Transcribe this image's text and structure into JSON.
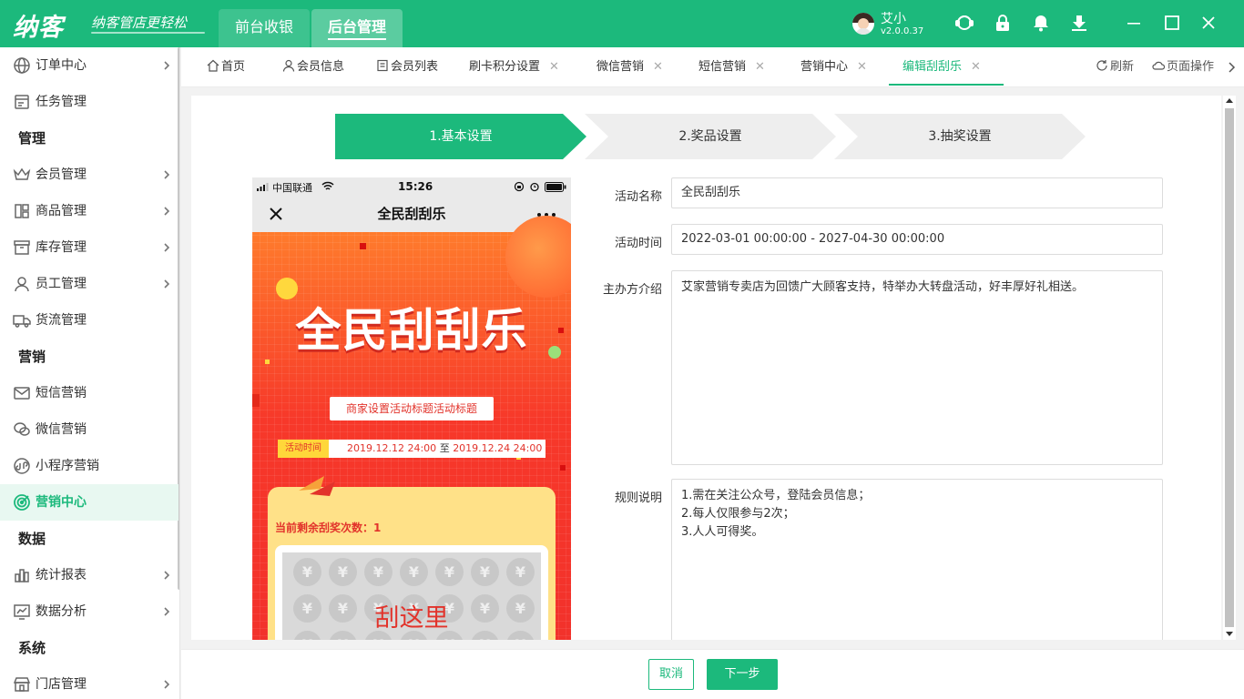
{
  "brand": {
    "logo": "纳客",
    "slogan": "纳客管店更轻松",
    "accent_color": "#1cb97c"
  },
  "main_tabs": [
    {
      "label": "前台收银"
    },
    {
      "label": "后台管理"
    }
  ],
  "user": {
    "name": "艾小",
    "version": "v2.0.0.37"
  },
  "sidebar": {
    "items": [
      {
        "label": "订单中心",
        "icon": "globe-icon"
      },
      {
        "label": "任务管理",
        "icon": "task-icon"
      },
      {
        "label": "会员管理",
        "icon": "crown-icon"
      },
      {
        "label": "商品管理",
        "icon": "grid-icon"
      },
      {
        "label": "库存管理",
        "icon": "box-icon"
      },
      {
        "label": "员工管理",
        "icon": "user-icon"
      },
      {
        "label": "货流管理",
        "icon": "truck-icon"
      },
      {
        "label": "短信营销",
        "icon": "mail-icon"
      },
      {
        "label": "微信营销",
        "icon": "wechat-icon"
      },
      {
        "label": "小程序营销",
        "icon": "miniprogram-icon"
      },
      {
        "label": "营销中心",
        "icon": "target-icon"
      },
      {
        "label": "统计报表",
        "icon": "bar-chart-icon"
      },
      {
        "label": "数据分析",
        "icon": "trend-icon"
      },
      {
        "label": "门店管理",
        "icon": "store-icon"
      }
    ],
    "groups": [
      "管理",
      "营销",
      "数据",
      "系统"
    ]
  },
  "tabs": [
    {
      "label": "首页",
      "closable": false
    },
    {
      "label": "会员信息",
      "closable": false
    },
    {
      "label": "会员列表",
      "closable": false
    },
    {
      "label": "刷卡积分设置",
      "closable": true
    },
    {
      "label": "微信营销",
      "closable": true
    },
    {
      "label": "短信营销",
      "closable": true
    },
    {
      "label": "营销中心",
      "closable": true
    },
    {
      "label": "编辑刮刮乐",
      "closable": true
    }
  ],
  "tab_actions": {
    "refresh": "刷新",
    "page_ops": "页面操作"
  },
  "steps": [
    "1.基本设置",
    "2.奖品设置",
    "3.抽奖设置"
  ],
  "phone": {
    "carrier": "中国联通",
    "time": "15:26",
    "title": "全民刮刮乐",
    "banner": "全民刮刮乐",
    "subtitle": "商家设置活动标题活动标题",
    "time_label": "活动时间",
    "time_start": "2019.12.12 24:00",
    "time_sep": "至",
    "time_end": "2019.12.24 24:00",
    "remaining": "当前剩余刮奖次数：1",
    "scratch_text": "刮这里",
    "coin_symbol": "¥"
  },
  "form": {
    "name_label": "活动名称",
    "name_value": "全民刮刮乐",
    "time_label": "活动时间",
    "time_value": "2022-03-01 00:00:00 - 2027-04-30 00:00:00",
    "org_label": "主办方介绍",
    "org_value": "艾家营销专卖店为回馈广大顾客支持，特举办大转盘活动，好丰厚好礼相送。",
    "rules_label": "规则说明",
    "rules_lines": [
      "1.需在关注公众号，登陆会员信息；",
      "2.每人仅限参与2次；",
      "3.人人可得奖。"
    ]
  },
  "buttons": {
    "cancel": "取消",
    "next": "下一步"
  }
}
